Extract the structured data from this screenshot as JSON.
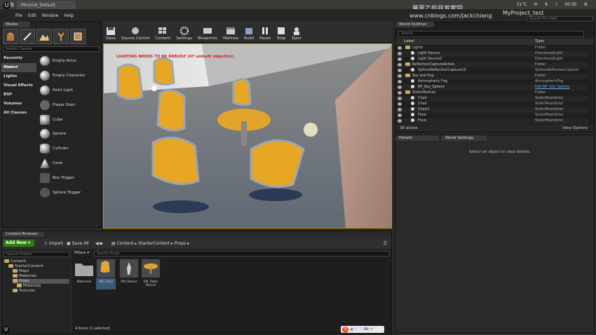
{
  "window": {
    "tab_title": "Minimal_Default",
    "project_name": "MyProject_test",
    "watermark_cn": "蒋至乙的开发家园",
    "watermark_url": "www.cnblogs.com/jackchiang",
    "status": {
      "temp": "31°C",
      "time": "00:35"
    }
  },
  "menu": [
    "File",
    "Edit",
    "Window",
    "Help"
  ],
  "help_search_placeholder": "Search For Help",
  "modes": {
    "tab": "Modes",
    "search_placeholder": "Search Classes",
    "categories": [
      "Recently Placed",
      "Basic",
      "Lights",
      "Visual Effects",
      "BSP",
      "Volumes",
      "All Classes"
    ],
    "active_category": "Basic",
    "placeables": [
      "Empty Actor",
      "Empty Character",
      "Point Light",
      "Player Start",
      "Cube",
      "Sphere",
      "Cylinder",
      "Cone",
      "Box Trigger",
      "Sphere Trigger"
    ]
  },
  "toolbar": [
    "Save",
    "Source Control",
    "Content",
    "Settings",
    "Blueprints",
    "Matinee",
    "Build",
    "Pause",
    "Stop",
    "Eject"
  ],
  "viewport": {
    "warning": "LIGHTING NEEDS TO BE REBUILT (47 unbuilt object(s))"
  },
  "outliner": {
    "tab": "World Outliner",
    "search_placeholder": "Search...",
    "columns": [
      "Label",
      "Type"
    ],
    "rows": [
      {
        "label": "Lights",
        "type": "Folder",
        "indent": 1,
        "folder": true
      },
      {
        "label": "Light Source",
        "type": "DirectionalLight",
        "indent": 2
      },
      {
        "label": "Light Source2",
        "type": "DirectionalLight",
        "indent": 2
      },
      {
        "label": "ReflectionCaptureActors",
        "type": "Folder",
        "indent": 1,
        "folder": true
      },
      {
        "label": "SphereReflectionCapture10",
        "type": "SphereReflectionCapture",
        "indent": 2
      },
      {
        "label": "Sky and Fog",
        "type": "Folder",
        "indent": 1,
        "folder": true
      },
      {
        "label": "Atmospheric Fog",
        "type": "AtmosphericFog",
        "indent": 2
      },
      {
        "label": "BP_Sky_Sphere",
        "type": "Edit BP_Sky_Sphere",
        "indent": 2,
        "link": true
      },
      {
        "label": "StaticMeshes",
        "type": "Folder",
        "indent": 1,
        "folder": true
      },
      {
        "label": "Chair",
        "type": "StaticMeshActor",
        "indent": 2
      },
      {
        "label": "Chair",
        "type": "StaticMeshActor",
        "indent": 2
      },
      {
        "label": "Chair2",
        "type": "StaticMeshActor",
        "indent": 2
      },
      {
        "label": "Floor",
        "type": "StaticMeshActor",
        "indent": 2
      },
      {
        "label": "Floor",
        "type": "StaticMeshActor",
        "indent": 2
      }
    ],
    "actor_count": "38 actors",
    "view_options": "View Options"
  },
  "details": {
    "tabs": [
      "Details",
      "World Settings"
    ],
    "empty_message": "Select an object to view details."
  },
  "content_browser": {
    "tab": "Content Browser",
    "add_new": "Add New",
    "import": "Import",
    "save_all": "Save All",
    "path": [
      "Content",
      "StarterContent",
      "Props"
    ],
    "folder_search_placeholder": "Search Folders",
    "filters": "Filters",
    "asset_search_placeholder": "Search Props",
    "tree": [
      {
        "label": "Content",
        "indent": 0
      },
      {
        "label": "StarterContent",
        "indent": 1
      },
      {
        "label": "Maps",
        "indent": 2
      },
      {
        "label": "Materials",
        "indent": 2
      },
      {
        "label": "Props",
        "indent": 2,
        "selected": true
      },
      {
        "label": "Materials",
        "indent": 3
      },
      {
        "label": "Textures",
        "indent": 2
      }
    ],
    "assets": [
      {
        "label": "Materials",
        "kind": "folder"
      },
      {
        "label": "SM_Chair",
        "kind": "mesh",
        "selected": true
      },
      {
        "label": "SM_Statue",
        "kind": "mesh"
      },
      {
        "label": "SM_Table Round",
        "kind": "mesh"
      }
    ],
    "status": "4 items (1 selected)",
    "ime_label": "英"
  },
  "colors": {
    "accent": "#c49a00",
    "add_new": "#2f7d12",
    "warning": "#d41c1c"
  }
}
